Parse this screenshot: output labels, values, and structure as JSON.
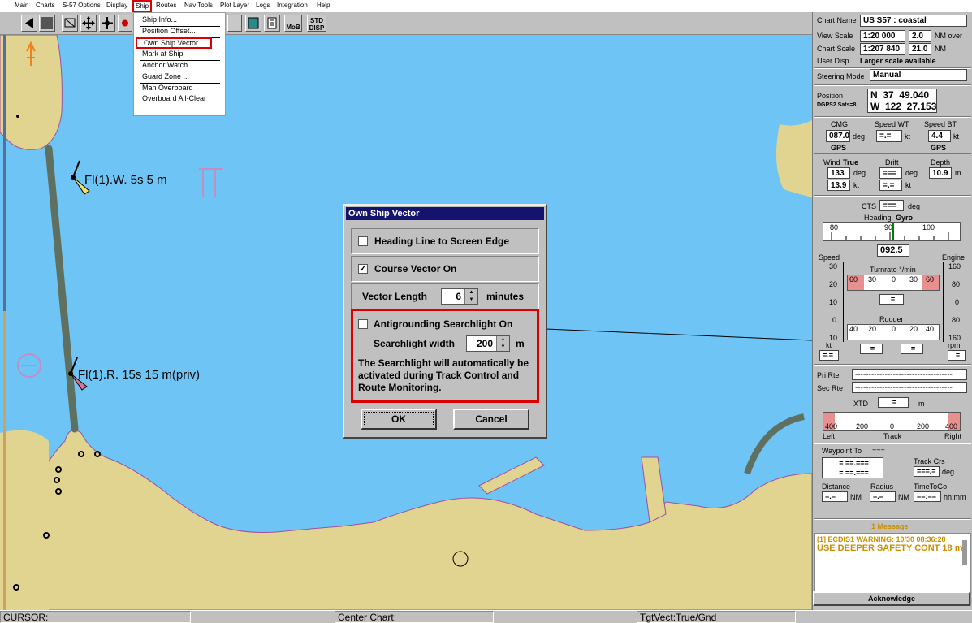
{
  "menubar": {
    "items": [
      "Main",
      "Charts",
      "S-57 Options",
      "Display",
      "Ship",
      "Routes",
      "Nav Tools",
      "Plot Layer",
      "Logs",
      "Integration",
      "Help"
    ]
  },
  "toolbar": {
    "mob_label": "MoB",
    "std_disp_label": "STD DISP"
  },
  "ship_menu": {
    "items": [
      "Ship Info...",
      "Position Offset...",
      "Own Ship Vector...",
      "Mark at Ship",
      "Anchor Watch...",
      "Guard Zone ...",
      "Man Overboard",
      "Overboard All-Clear"
    ]
  },
  "chart": {
    "light1": "Fl(1).W. 5s 5 m",
    "light2": "Fl(1).R. 15s 15 m(priv)"
  },
  "dialog": {
    "title": "Own Ship Vector",
    "heading_line_label": "Heading Line to Screen Edge",
    "heading_line_checked": false,
    "course_vector_label": "Course Vector On",
    "course_vector_checked": true,
    "vector_length_label": "Vector Length",
    "vector_length_value": "6",
    "vector_length_unit": "minutes",
    "searchlight_label": "Antigrounding Searchlight On",
    "searchlight_checked": false,
    "searchlight_width_label": "Searchlight width",
    "searchlight_width_value": "200",
    "searchlight_width_unit": "m",
    "note": "The Searchlight will automatically be activated during Track Control and Route Monitoring.",
    "ok_label": "OK",
    "cancel_label": "Cancel",
    "highlight_color": "#dd0000"
  },
  "panel": {
    "chart_name_label": "Chart Name",
    "chart_name": "US S57 : coastal",
    "view_scale_label": "View Scale",
    "view_scale": "1:20 000",
    "view_scale_nm": "2.0",
    "view_scale_suffix": "NM over",
    "chart_scale_label": "Chart Scale",
    "chart_scale": "1:207 840",
    "chart_scale_nm": "21.0",
    "chart_scale_suffix": "NM",
    "user_disp_label": "User Disp",
    "user_disp": "Larger scale available",
    "steering_mode_label": "Steering Mode",
    "steering_mode": "Manual",
    "position_label": "Position",
    "position_source": "DGPS2 Sats=8",
    "lat": "N  37  49.040",
    "lon": "W  122  27.153",
    "cmg_label": "CMG",
    "cmg": "087.0",
    "cmg_unit": "deg",
    "cmg_src": "GPS",
    "speed_wt_label": "Speed WT",
    "speed_wt": "=.=",
    "speed_wt_unit": "kt",
    "speed_bt_label": "Speed BT",
    "speed_bt": "4.4",
    "speed_bt_unit": "kt",
    "speed_bt_src": "GPS",
    "wind_label": "Wind",
    "wind_mode": "True",
    "wind_dir": "133",
    "wind_dir_unit": "deg",
    "wind_speed": "13.9",
    "wind_speed_unit": "kt",
    "drift_label": "Drift",
    "drift_dir": "===",
    "drift_dir_unit": "deg",
    "drift_speed": "=.=",
    "drift_speed_unit": "kt",
    "depth_label": "Depth",
    "depth": "10.9",
    "depth_unit": "m",
    "cts_label": "CTS",
    "cts": "===",
    "cts_unit": "deg",
    "heading_label": "Heading",
    "heading_src": "Gyro",
    "heading_ticks": [
      "80",
      "90",
      "100"
    ],
    "heading": "092.5",
    "speed_label": "Speed",
    "speed_ticks": [
      "30",
      "20",
      "10",
      "0",
      "10"
    ],
    "speed_unit": "kt",
    "speed_val": "=.=",
    "turnrate_label": "Turnrate °/min",
    "turnrate_ticks": [
      "60",
      "30",
      "0",
      "30",
      "60"
    ],
    "turnrate_val": "=",
    "rudder_label": "Rudder",
    "rudder_ticks": [
      "40",
      "20",
      "0",
      "20",
      "40"
    ],
    "rudder_val1": "=",
    "rudder_val2": "=",
    "engine_label": "Engine",
    "engine_ticks": [
      "160",
      "80",
      "0",
      "80",
      "160"
    ],
    "engine_unit": "rpm",
    "engine_val": "=",
    "pri_rte_label": "Pri Rte",
    "pri_rte": "------------------------------------",
    "sec_rte_label": "Sec Rte",
    "sec_rte": "------------------------------------",
    "xtd_label": "XTD",
    "xtd": "=",
    "xtd_unit": "m",
    "xtd_ticks": [
      "400",
      "200",
      "0",
      "200",
      "400"
    ],
    "xtd_left": "Left",
    "xtd_track": "Track",
    "xtd_right": "Right",
    "waypoint_label": "Waypoint To",
    "waypoint_id": "===",
    "waypoint_lat": "=  ==.===",
    "waypoint_lon": "=  ==.===",
    "track_crs_label": "Track Crs",
    "track_crs": "===.=",
    "track_crs_unit": "deg",
    "distance_label": "Distance",
    "distance": "=.=",
    "distance_unit": "NM",
    "radius_label": "Radius",
    "radius": "=.=",
    "radius_unit": "NM",
    "ttg_label": "TimeToGo",
    "ttg": "==:==",
    "ttg_unit": "hh:mm",
    "messages_header": "1 Message",
    "message_line1": "[1] ECDIS1 WARNING: 10/30 08:36:28",
    "message_line2": "USE DEEPER SAFETY CONT 18 m",
    "acknowledge_label": "Acknowledge"
  },
  "statusbar": {
    "cursor_label": "CURSOR:",
    "center_chart_label": "Center Chart:",
    "tgt_vect_label": "TgtVect:True/Gnd"
  }
}
